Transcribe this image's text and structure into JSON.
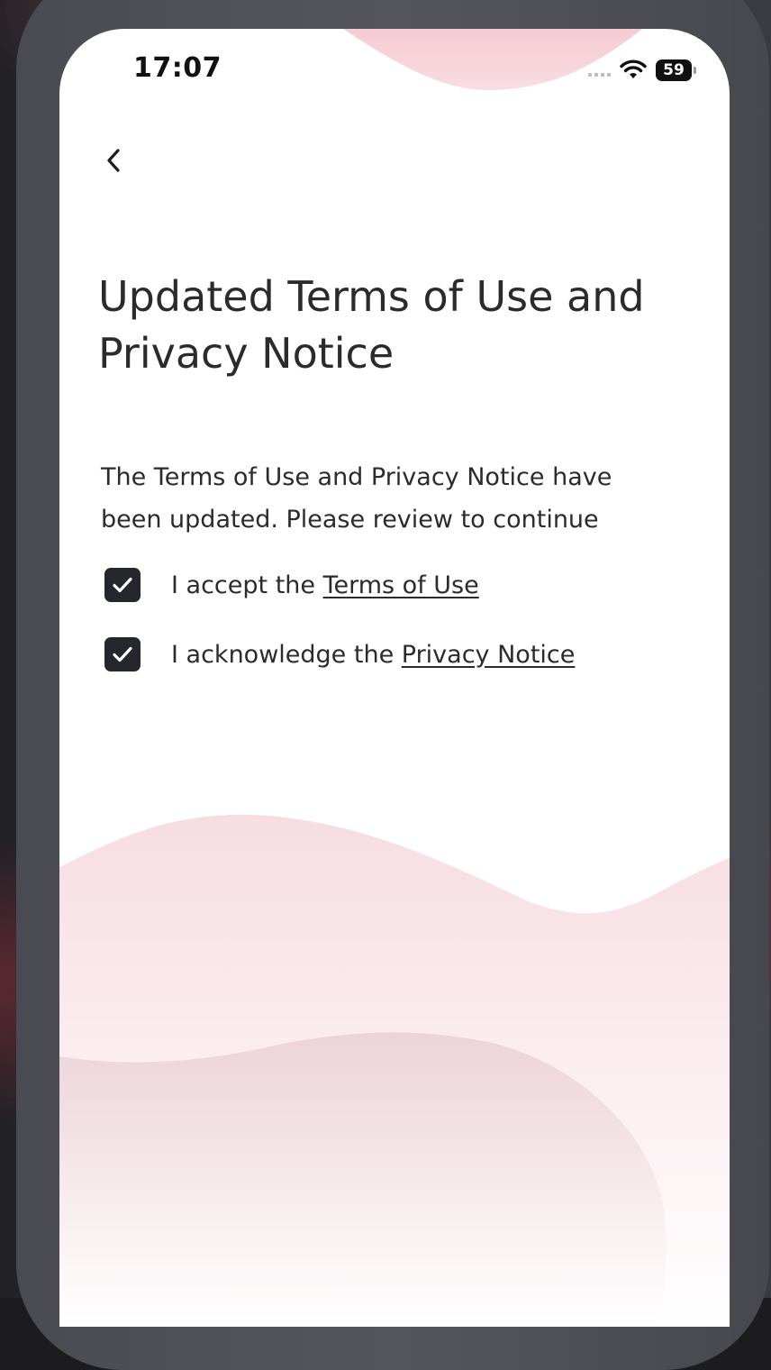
{
  "status_bar": {
    "time": "17:07",
    "battery": "59"
  },
  "navigation": {
    "back_icon": "chevron-left-icon"
  },
  "page": {
    "title": "Updated Terms of Use and Privacy Notice",
    "description": "The Terms of Use and Privacy Notice have been updated. Please review to continue"
  },
  "consents": [
    {
      "prefix": "I accept the ",
      "link_label": "Terms of Use",
      "checked": true
    },
    {
      "prefix": "I acknowledge the ",
      "link_label": "Privacy Notice",
      "checked": true
    }
  ],
  "colors": {
    "accent_dark": "#26272c",
    "wave_pink": "#f5d6dc",
    "text": "#2b2b2e"
  }
}
